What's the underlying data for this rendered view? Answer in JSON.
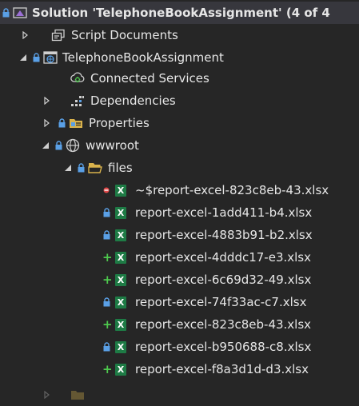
{
  "solution": {
    "label": "Solution 'TelephoneBookAssignment' (4 of 4"
  },
  "script_documents": {
    "label": "Script Documents"
  },
  "project": {
    "label": "TelephoneBookAssignment"
  },
  "connected_services": {
    "label": "Connected Services"
  },
  "dependencies": {
    "label": "Dependencies"
  },
  "properties": {
    "label": "Properties"
  },
  "wwwroot": {
    "label": "wwwroot"
  },
  "files_folder": {
    "label": "files"
  },
  "files": [
    {
      "name": "~$report-excel-823c8eb-43.xlsx",
      "status": "excluded"
    },
    {
      "name": "report-excel-1add411-b4.xlsx",
      "status": "locked"
    },
    {
      "name": "report-excel-4883b91-b2.xlsx",
      "status": "locked"
    },
    {
      "name": "report-excel-4dddc17-e3.xlsx",
      "status": "added"
    },
    {
      "name": "report-excel-6c69d32-49.xlsx",
      "status": "added"
    },
    {
      "name": "report-excel-74f33ac-c7.xlsx",
      "status": "locked"
    },
    {
      "name": "report-excel-823c8eb-43.xlsx",
      "status": "added"
    },
    {
      "name": "report-excel-b950688-c8.xlsx",
      "status": "locked"
    },
    {
      "name": "report-excel-f8a3d1d-d3.xlsx",
      "status": "added"
    }
  ],
  "colors": {
    "background": "#262626",
    "text": "#e6e6e6",
    "lock": "#5aa0e6",
    "added": "#4ec94e",
    "excluded": "#e04848",
    "excel": "#1e7b45",
    "folder": "#d9b24c"
  }
}
